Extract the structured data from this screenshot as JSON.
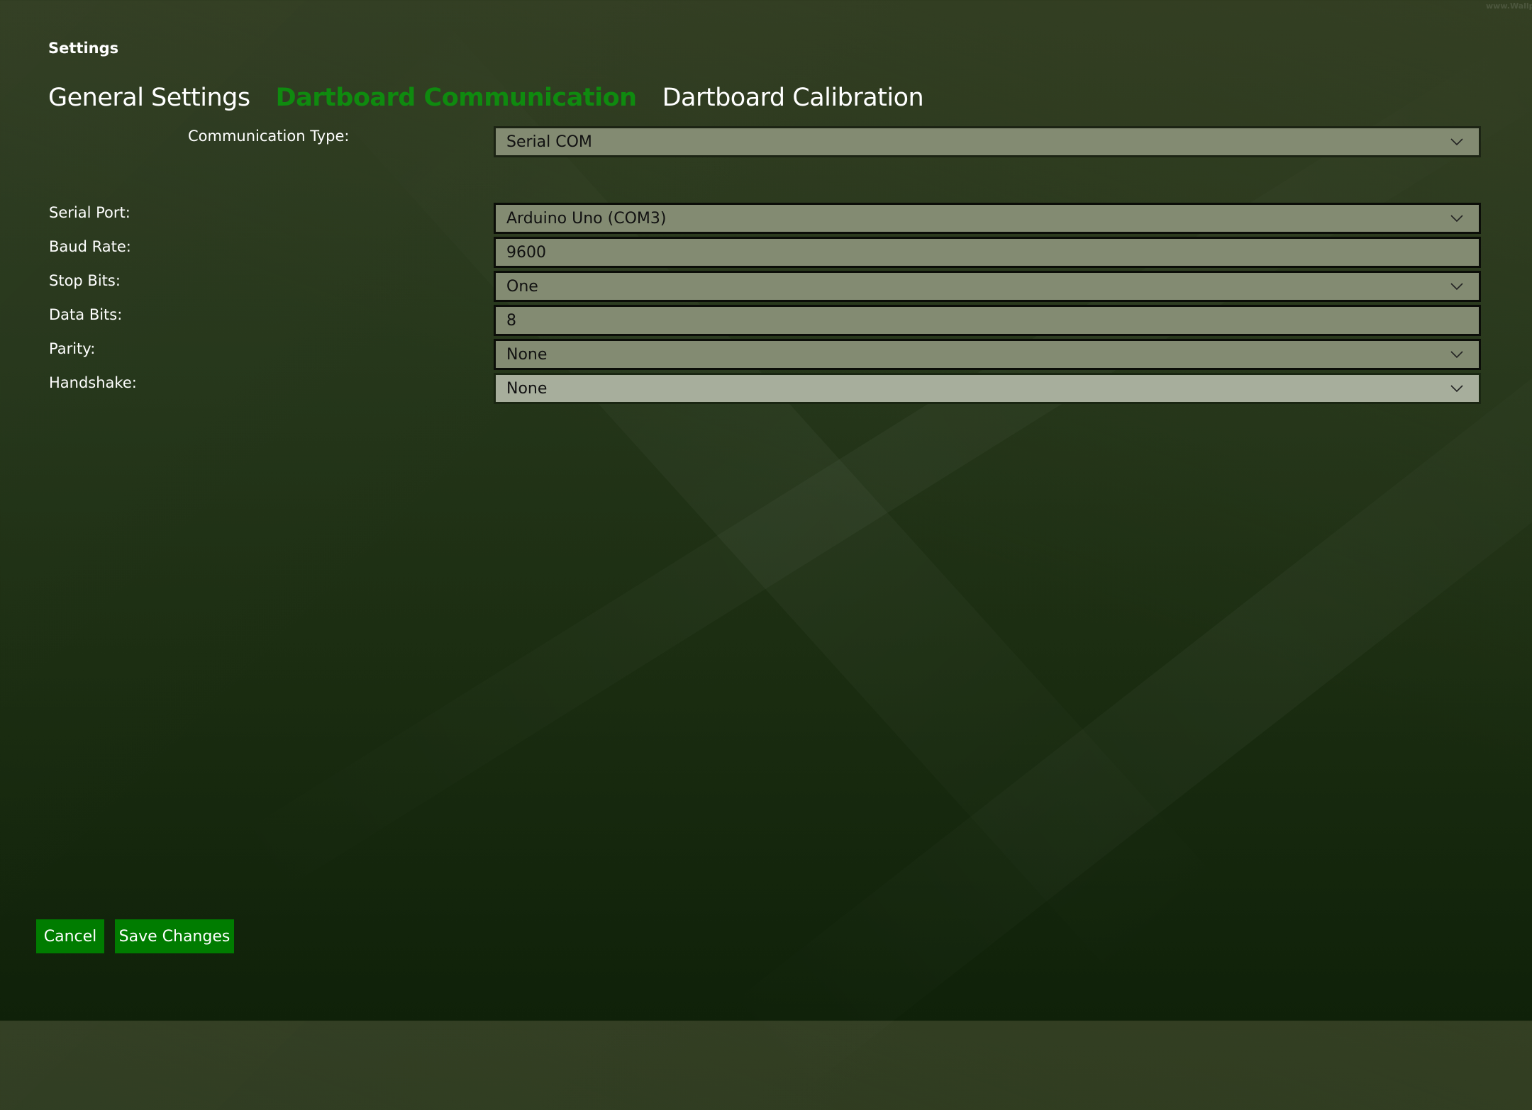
{
  "watermark": "www.Wallpa",
  "page_title": "Settings",
  "tabs": [
    {
      "label": "General Settings",
      "active": false
    },
    {
      "label": "Dartboard Communication",
      "active": true
    },
    {
      "label": "Dartboard Calibration",
      "active": false
    }
  ],
  "communication_type": {
    "label": "Communication Type:",
    "value": "Serial COM",
    "icon": "chevron-down-icon"
  },
  "serial": {
    "port": {
      "label": "Serial Port:",
      "value": "Arduino Uno (COM3)",
      "icon": "chevron-down-icon"
    },
    "baud_rate": {
      "label": "Baud Rate:",
      "value": "9600"
    },
    "stop_bits": {
      "label": "Stop Bits:",
      "value": "One",
      "icon": "chevron-down-icon"
    },
    "data_bits": {
      "label": "Data Bits:",
      "value": "8"
    },
    "parity": {
      "label": "Parity:",
      "value": "None",
      "icon": "chevron-down-icon"
    },
    "handshake": {
      "label": "Handshake:",
      "value": "None",
      "icon": "chevron-down-icon"
    }
  },
  "buttons": {
    "cancel": "Cancel",
    "save": "Save Changes"
  },
  "colors": {
    "accent": "#007c00",
    "active_tab": "#0f8a0f",
    "field_bg": "#838b72",
    "field_hover_bg": "#a7ae9c"
  }
}
